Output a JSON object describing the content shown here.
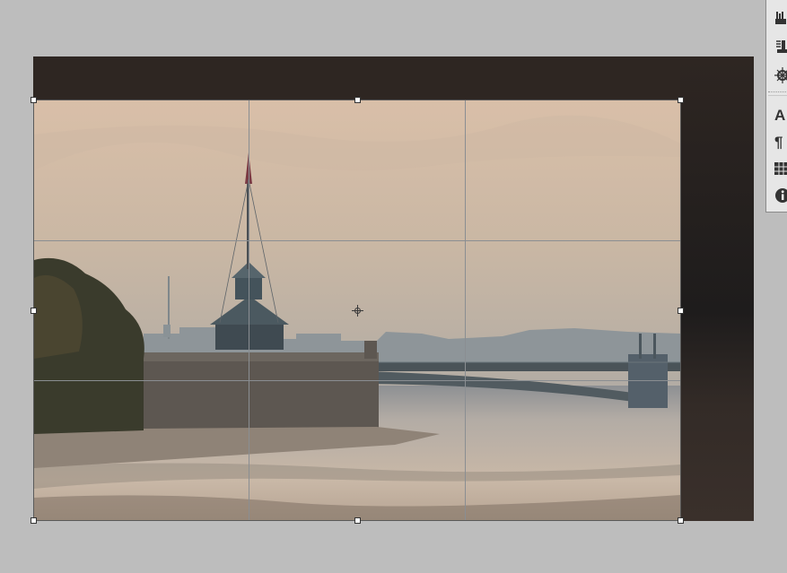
{
  "app": {
    "name": "photo editor",
    "mode": "crop"
  },
  "crop": {
    "overlay": "rule-of-thirds",
    "handles": [
      "top-left",
      "top-center",
      "top-right",
      "middle-left",
      "middle-right",
      "bottom-left",
      "bottom-center",
      "bottom-right"
    ]
  },
  "colors": {
    "workspace": "#bdbdbd",
    "panel": "#e6e6e6",
    "photo_dark_band": "#2e2622",
    "crop_border": "#5a5a5a",
    "grid_line": "#8a8e92"
  },
  "toolbar": {
    "items": [
      {
        "icon": "brush-presets-icon",
        "glyph": ""
      },
      {
        "icon": "clone-source-icon",
        "glyph": ""
      },
      {
        "icon": "3d-navigation-icon",
        "glyph": ""
      },
      {
        "icon": "character-panel-icon",
        "glyph": "A"
      },
      {
        "icon": "paragraph-panel-icon",
        "glyph": "¶"
      },
      {
        "icon": "swatches-icon",
        "glyph": ""
      },
      {
        "icon": "info-panel-icon",
        "glyph": ""
      }
    ]
  }
}
